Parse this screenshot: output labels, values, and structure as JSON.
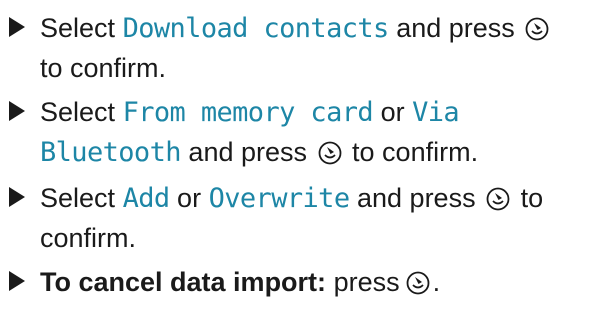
{
  "colors": {
    "display_text": "#1d86a6",
    "body_text": "#1a1a1a"
  },
  "icons": {
    "bullet": "triangle-right-icon",
    "controller": "controller-press-icon"
  },
  "steps": [
    {
      "select": "Select",
      "option": "Download contacts",
      "and_press": "and press",
      "to_confirm": "to confirm."
    },
    {
      "select": "Select",
      "option_a": "From memory card",
      "or": "or",
      "option_b_line1": "Via",
      "option_b_line2": "Bluetooth",
      "and_press": "and press",
      "to_confirm": "to confirm."
    },
    {
      "select": "Select",
      "option_a": "Add",
      "or": "or",
      "option_b": "Overwrite",
      "and_press": "and press",
      "to": "to",
      "confirm": "confirm."
    },
    {
      "bold_label": "To cancel data import:",
      "press": "press",
      "period": "."
    }
  ]
}
